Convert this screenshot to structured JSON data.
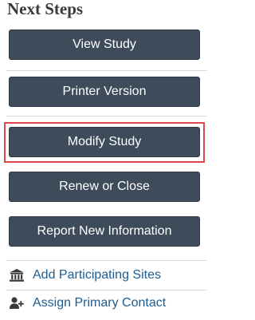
{
  "panel": {
    "title": "Next Steps"
  },
  "buttons": {
    "view_study": "View Study",
    "printer_version": "Printer Version",
    "modify_study": "Modify Study",
    "renew_or_close": "Renew or Close",
    "report_new_information": "Report New Information"
  },
  "links": {
    "add_participating_sites": {
      "label": "Add Participating Sites",
      "icon": "institution-icon"
    },
    "assign_primary_contact": {
      "label": "Assign Primary Contact",
      "icon": "user-add-icon"
    }
  },
  "colors": {
    "button_bg": "#3d4b5a",
    "link": "#1f5c8f",
    "highlight": "#e0474c"
  }
}
